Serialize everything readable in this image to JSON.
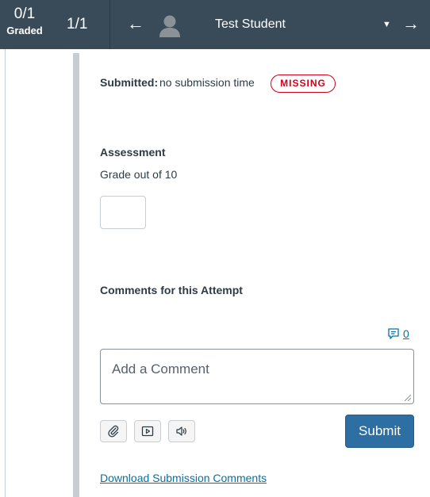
{
  "header": {
    "graded_count": "0/1",
    "graded_label": "Graded",
    "student_position": "1/1",
    "prev_icon": "arrow-left-icon",
    "next_icon": "arrow-right-icon",
    "student_name": "Test Student",
    "dropdown_icon": "caret-down-icon",
    "background_color": "#394b58"
  },
  "submission": {
    "label": "Submitted:",
    "value": "no submission time",
    "status_badge": "MISSING",
    "status_color": "#d0021b"
  },
  "assessment": {
    "title": "Assessment",
    "grade_label": "Grade out of 10",
    "grade_value": ""
  },
  "comments": {
    "title": "Comments for this Attempt",
    "count": "0",
    "placeholder": "Add a Comment",
    "tools": [
      "paperclip-icon",
      "video-icon",
      "audio-icon"
    ],
    "submit_label": "Submit",
    "download_link": "Download Submission Comments",
    "submit_color": "#2d6ea3",
    "link_color": "#0770a3"
  }
}
